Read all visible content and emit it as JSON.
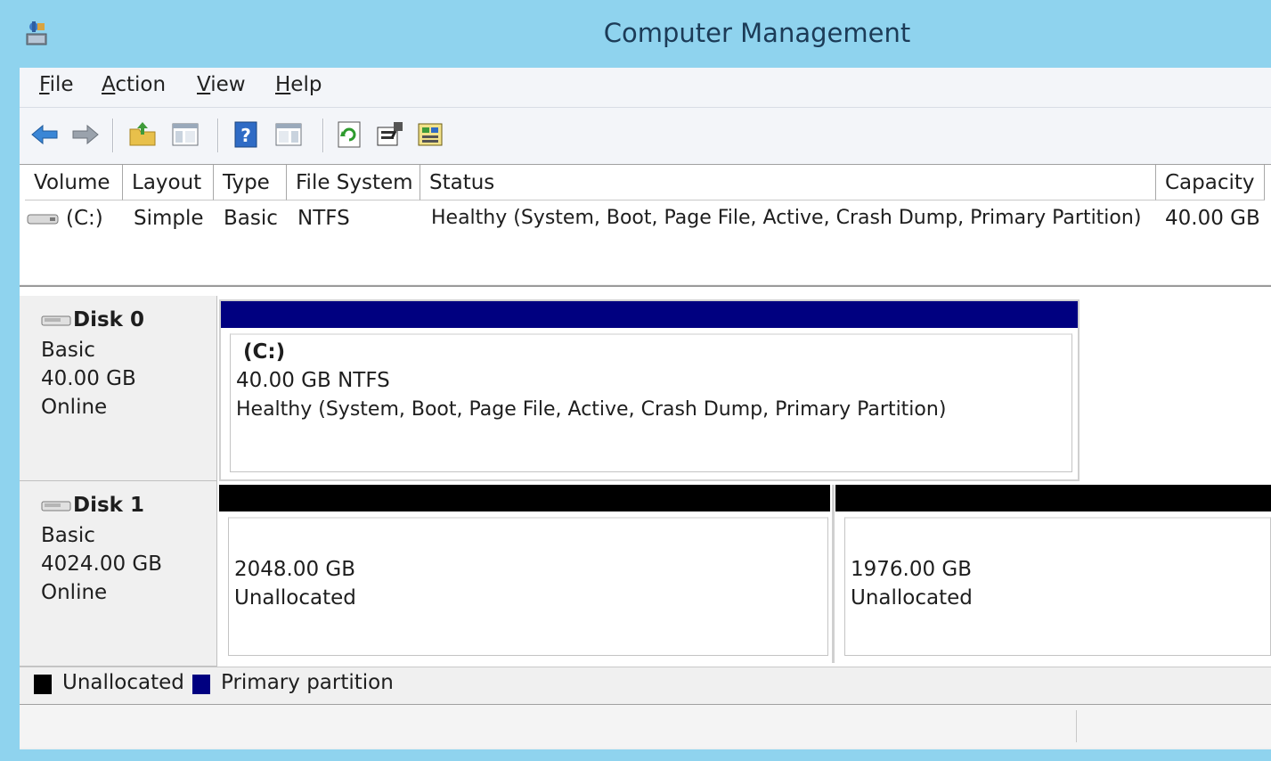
{
  "window": {
    "title": "Computer Management",
    "title_bar_color": "#8fd3ee"
  },
  "menu": [
    {
      "label": "File",
      "accel": "F",
      "rest": "ile"
    },
    {
      "label": "Action",
      "accel": "A",
      "rest": "ction"
    },
    {
      "label": "View",
      "accel": "V",
      "rest": "iew"
    },
    {
      "label": "Help",
      "accel": "H",
      "rest": "elp"
    }
  ],
  "toolbar": {
    "icons": [
      "back-arrow-icon",
      "forward-arrow-icon",
      "up-folder-icon",
      "show-hide-console-tree-icon",
      "help-icon",
      "show-hide-action-pane-icon",
      "refresh-icon",
      "properties-icon",
      "export-list-icon"
    ]
  },
  "volume_list": {
    "columns": [
      "Volume",
      "Layout",
      "Type",
      "File System",
      "Status",
      "Capacity"
    ],
    "rows": [
      {
        "volume": "(C:)",
        "layout": "Simple",
        "type": "Basic",
        "file_system": "NTFS",
        "status": "Healthy (System, Boot, Page File, Active, Crash Dump, Primary Partition)",
        "capacity": "40.00 GB"
      }
    ]
  },
  "disks": [
    {
      "name": "Disk 0",
      "type": "Basic",
      "size": "40.00 GB",
      "state": "Online",
      "partitions": [
        {
          "label": "(C:)",
          "size_fs": "40.00 GB NTFS",
          "status": "Healthy (System, Boot, Page File, Active, Crash Dump, Primary Partition)",
          "bar_color": "#000080"
        }
      ]
    },
    {
      "name": "Disk 1",
      "type": "Basic",
      "size": "4024.00 GB",
      "state": "Online",
      "partitions": [
        {
          "size": "2048.00 GB",
          "status": "Unallocated",
          "bar_color": "#000000"
        },
        {
          "size": "1976.00 GB",
          "status": "Unallocated",
          "bar_color": "#000000"
        }
      ]
    }
  ],
  "legend": [
    {
      "label": "Unallocated",
      "color": "#000000"
    },
    {
      "label": "Primary partition",
      "color": "#000080"
    }
  ]
}
